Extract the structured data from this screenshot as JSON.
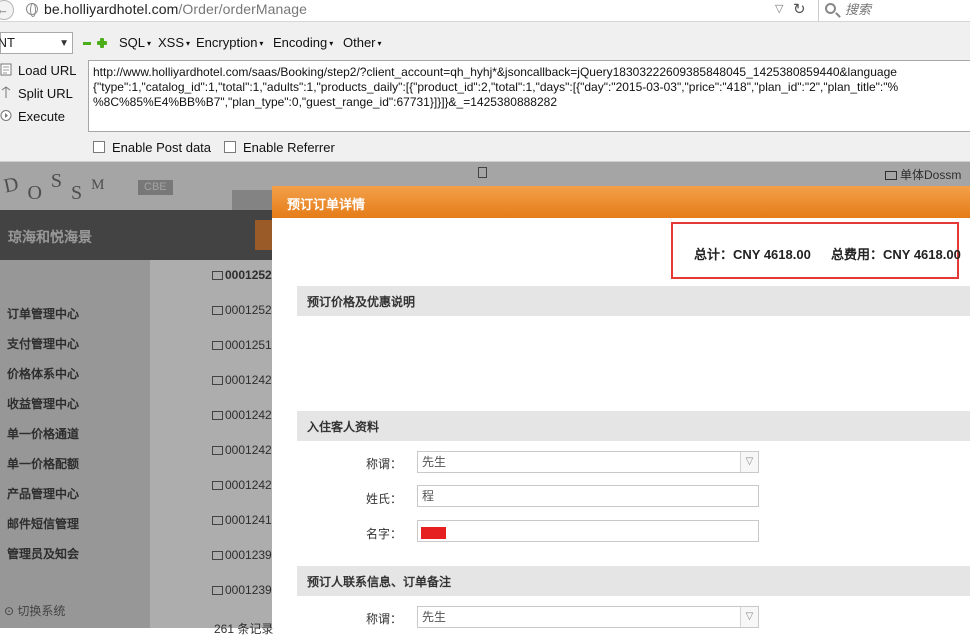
{
  "browser": {
    "url_host": "be.holliyardhotel.com",
    "url_path": "/Order/orderManage",
    "search_placeholder": "搜索"
  },
  "hackbar": {
    "int_select": "INT",
    "menus": [
      "SQL",
      "XSS",
      "Encryption",
      "Encoding",
      "Other"
    ],
    "buttons": {
      "load_url": "Load URL",
      "split_url": "Split URL",
      "execute": "Execute"
    },
    "url_lines": [
      "http://www.holliyardhotel.com/saas/Booking/step2/?client_account=qh_hyhj*&jsoncallback=jQuery18303222609385848045_1425380859440&language",
      "{\"type\":1,\"catalog_id\":1,\"total\":1,\"adults\":1,\"products_daily\":[{\"product_id\":2,\"total\":1,\"days\":[{\"day\":\"2015-03-03\",\"price\":\"418\",\"plan_id\":\"2\",\"plan_title\":\"%",
      "%8C%85%E4%BB%B7\",\"plan_type\":0,\"guest_range_id\":67731}]}]}&_=1425380888282"
    ],
    "enable_post": "Enable Post data",
    "enable_referrer": "Enable Referrer"
  },
  "page": {
    "logo": [
      "D",
      "O",
      "S",
      "S",
      "M"
    ],
    "logo_badge": "CBE",
    "user": "单体Dossm",
    "hotel_name": "琼海和悦海景",
    "nav": [
      "订单管理中心",
      "支付管理中心",
      "价格体系中心",
      "收益管理中心",
      "单一价格通道",
      "单一价格配额",
      "产品管理中心",
      "邮件短信管理",
      "管理员及知会"
    ],
    "switch_system": "切换系统",
    "order_ids": [
      "0001252",
      "0001252",
      "0001251",
      "0001242",
      "0001242",
      "0001242",
      "0001242",
      "0001241",
      "0001239",
      "0001239"
    ],
    "order_count": "261 条记录"
  },
  "modal": {
    "title": "预订订单详情",
    "total": "总计：CNY 4618.00",
    "fee": "总费用：CNY 4618.00",
    "sections": {
      "price": "预订价格及优惠说明",
      "guest": "入住客人资料",
      "contact": "预订人联系信息、订单备注"
    },
    "guest": {
      "title_label": "称谓：",
      "title_value": "先生",
      "surname_label": "姓氏：",
      "surname_value": "程",
      "name_label": "名字："
    },
    "contact": {
      "title_label": "称谓：",
      "title_value": "先生"
    }
  }
}
